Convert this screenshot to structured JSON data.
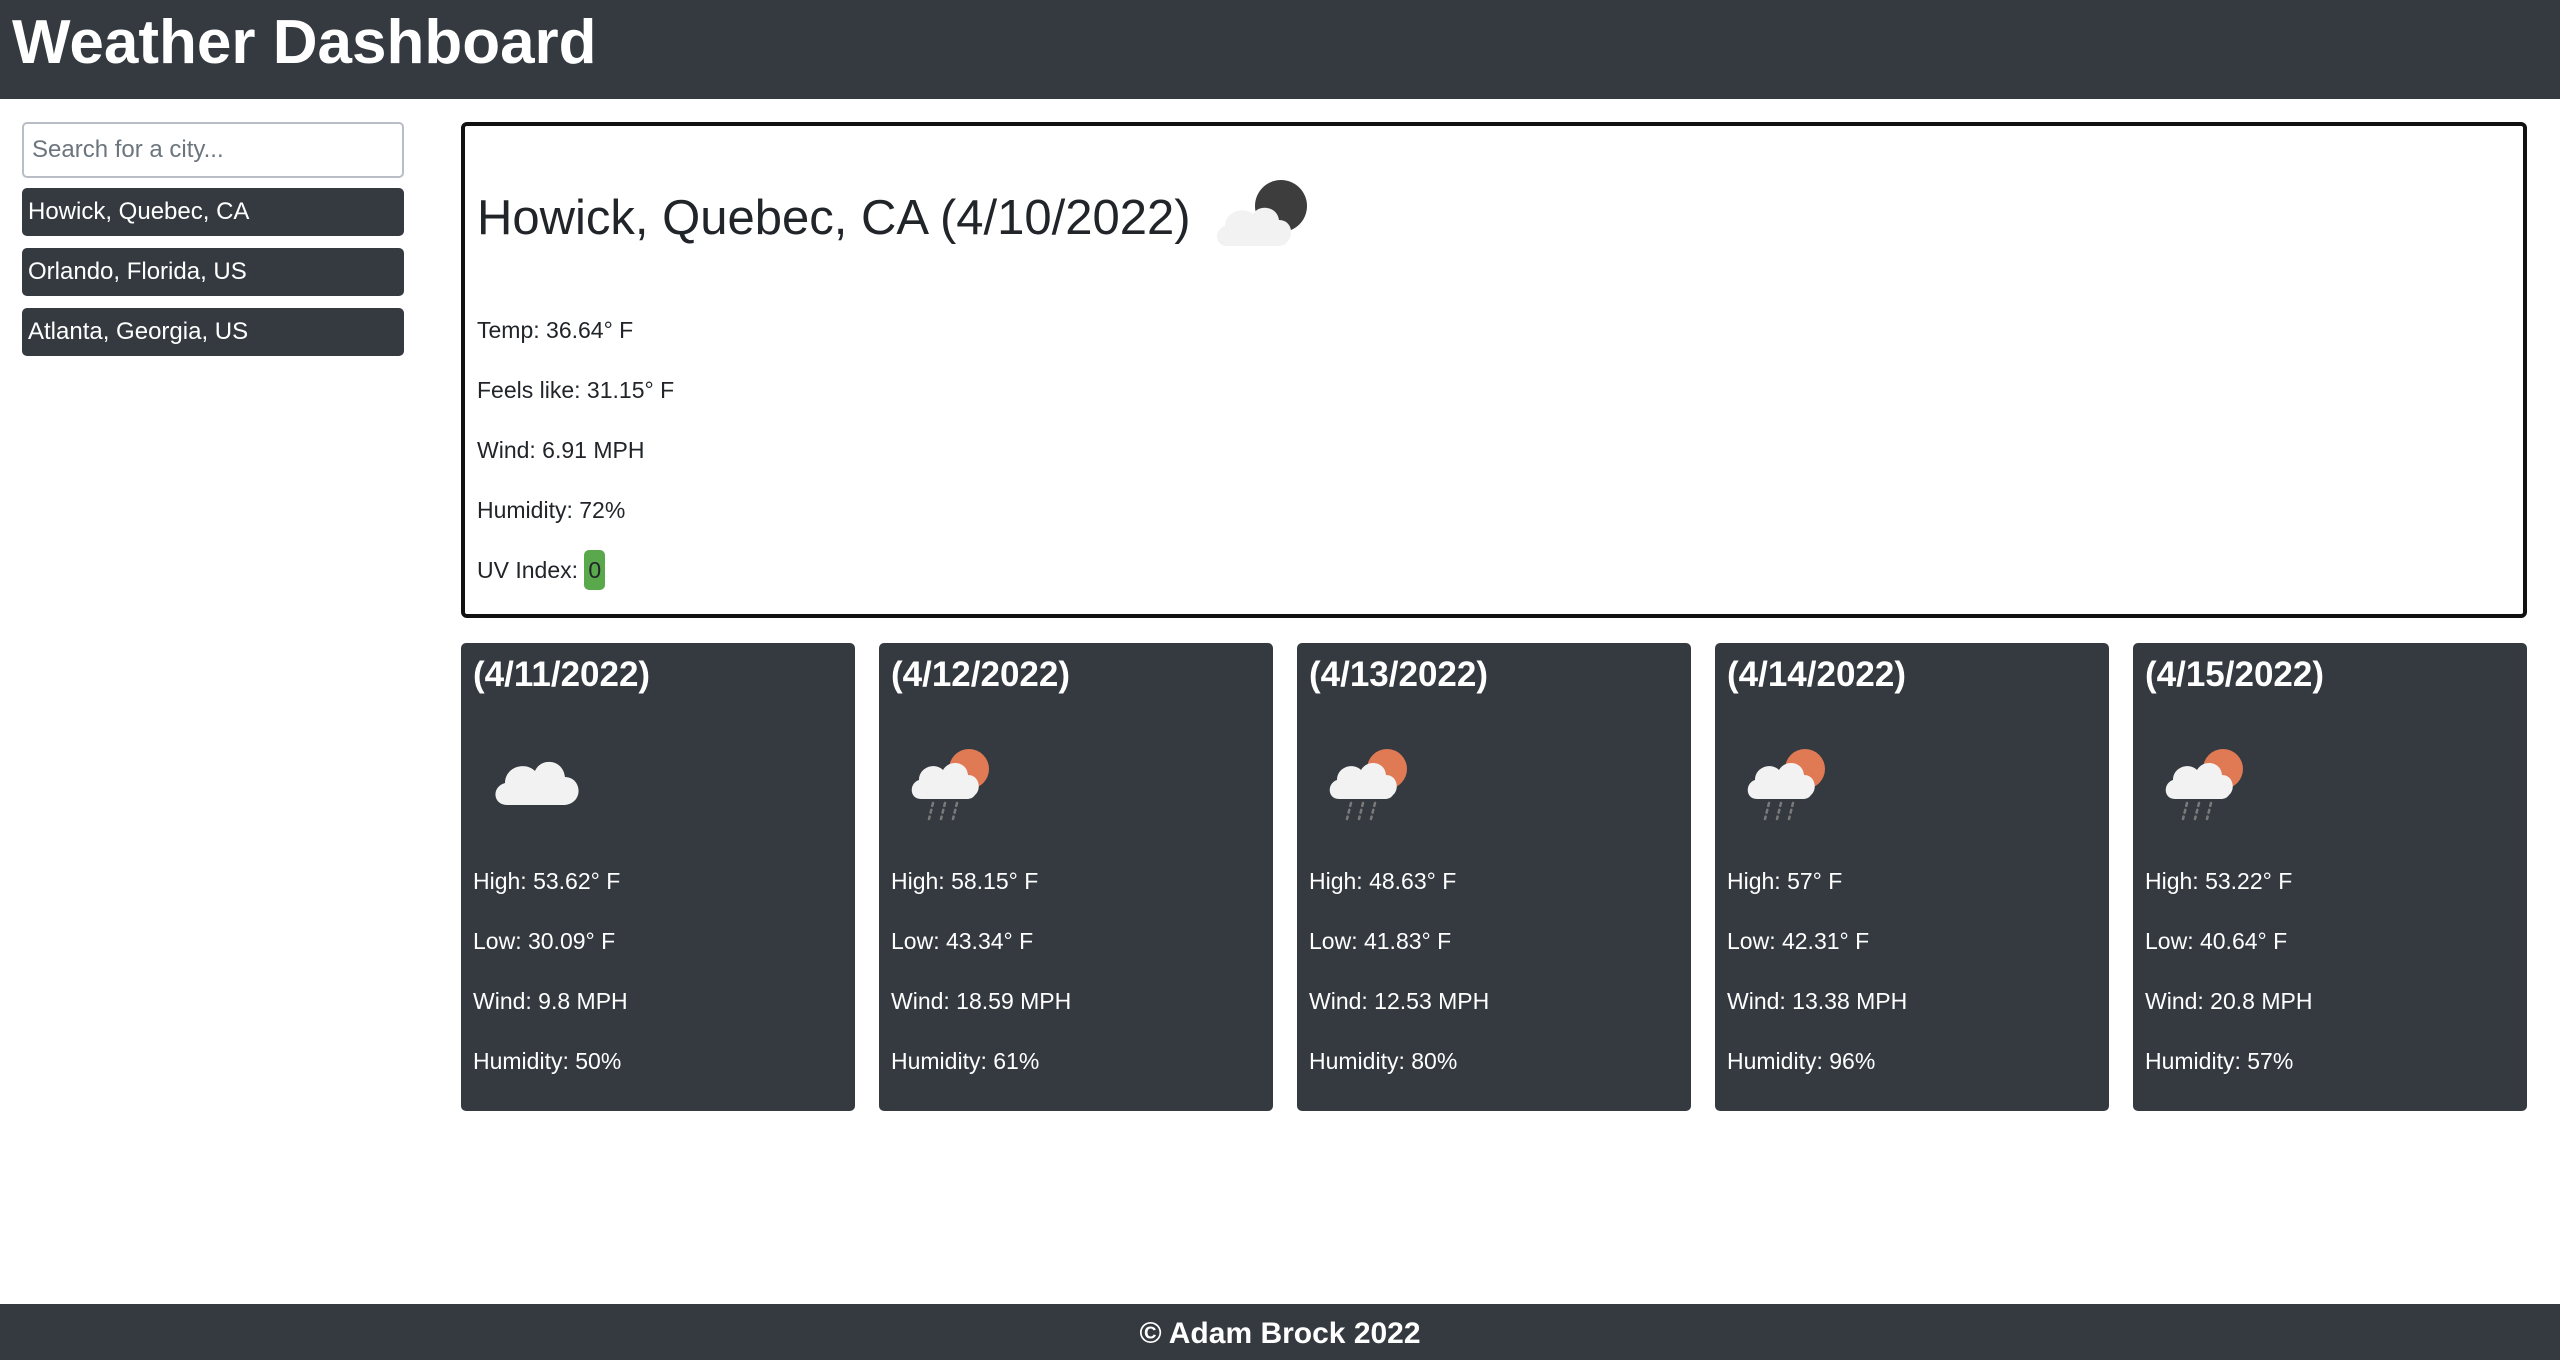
{
  "header": {
    "title": "Weather Dashboard"
  },
  "sidebar": {
    "search_placeholder": "Search for a city...",
    "history": [
      "Howick, Quebec, CA",
      "Orlando, Florida, US",
      "Atlanta, Georgia, US"
    ]
  },
  "current": {
    "title": "Howick, Quebec, CA (4/10/2022)",
    "icon": "night-cloud-icon",
    "temp": "Temp: 36.64° F",
    "feels_like": "Feels like: 31.15° F",
    "wind": "Wind: 6.91 MPH",
    "humidity": "Humidity: 72%",
    "uv_label": "UV Index:",
    "uv_value": "0"
  },
  "forecast": [
    {
      "date": "(4/11/2022)",
      "icon": "cloud-icon",
      "high": "High: 53.62° F",
      "low": "Low: 30.09° F",
      "wind": "Wind: 9.8 MPH",
      "humidity": "Humidity: 50%"
    },
    {
      "date": "(4/12/2022)",
      "icon": "sun-cloud-rain-icon",
      "high": "High: 58.15° F",
      "low": "Low: 43.34° F",
      "wind": "Wind: 18.59 MPH",
      "humidity": "Humidity: 61%"
    },
    {
      "date": "(4/13/2022)",
      "icon": "sun-cloud-rain-icon",
      "high": "High: 48.63° F",
      "low": "Low: 41.83° F",
      "wind": "Wind: 12.53 MPH",
      "humidity": "Humidity: 80%"
    },
    {
      "date": "(4/14/2022)",
      "icon": "sun-cloud-rain-icon",
      "high": "High: 57° F",
      "low": "Low: 42.31° F",
      "wind": "Wind: 13.38 MPH",
      "humidity": "Humidity: 96%"
    },
    {
      "date": "(4/15/2022)",
      "icon": "sun-cloud-rain-icon",
      "high": "High: 53.22° F",
      "low": "Low: 40.64° F",
      "wind": "Wind: 20.8 MPH",
      "humidity": "Humidity: 57%"
    }
  ],
  "footer": {
    "text": "© Adam Brock 2022"
  },
  "colors": {
    "dark": "#343a40",
    "uv_low": "#5aa84c",
    "sun": "#e07a55",
    "moon": "#3d3d3d",
    "cloud": "#f2f2f2"
  }
}
